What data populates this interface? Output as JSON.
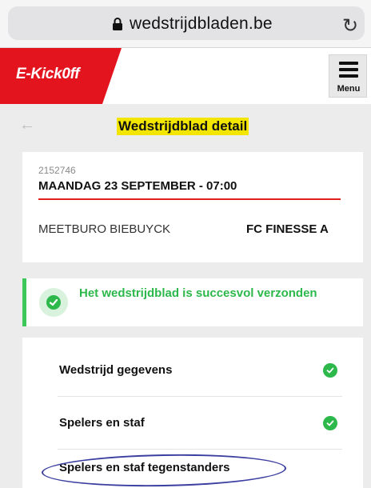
{
  "browser": {
    "url": "wedstrijdbladen.be",
    "lock_icon": "lock-icon",
    "reload_icon": "reload-icon"
  },
  "header": {
    "logo_text": "E-Kick0ff",
    "brand_color": "#e4141f",
    "menu_label": "Menu",
    "menu_icon": "hamburger-icon"
  },
  "page": {
    "back_icon": "back-arrow-icon",
    "title": "Wedstrijdblad detail",
    "title_highlight_color": "#f2e600"
  },
  "match": {
    "id": "2152746",
    "date_time": "MAANDAG 23 SEPTEMBER - 07:00",
    "home_team": "MEETBURO BIEBUYCK",
    "away_team": "FC FINESSE A"
  },
  "notice": {
    "message": "Het wedstrijdblad is succesvol verzonden",
    "status_color": "#2db84b",
    "icon": "check-circle-icon"
  },
  "sections": [
    {
      "label": "Wedstrijd gegevens",
      "completed": true
    },
    {
      "label": "Spelers en staf",
      "completed": true
    },
    {
      "label": "Spelers en staf tegenstanders",
      "completed": false
    }
  ]
}
